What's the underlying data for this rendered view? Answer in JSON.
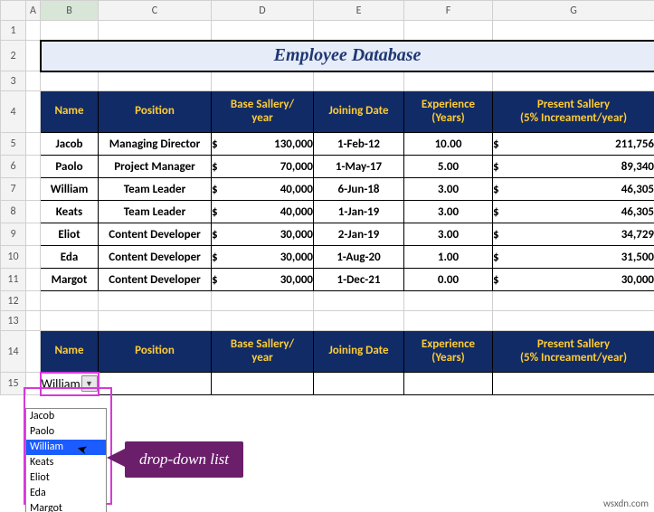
{
  "columns": [
    "A",
    "B",
    "C",
    "D",
    "E",
    "F",
    "G"
  ],
  "selected_column": "B",
  "title": "Employee Database",
  "headers": [
    "Name",
    "Position",
    "Base Sallery/\nyear",
    "Joining Date",
    "Experience\n(Years)",
    "Present Sallery\n(5% Increament/year)"
  ],
  "rows": [
    {
      "name": "Jacob",
      "position": "Managing Director",
      "base": "130,000",
      "join": "1-Feb-12",
      "exp": "10.00",
      "present": "211,756"
    },
    {
      "name": "Paolo",
      "position": "Project Manager",
      "base": "70,000",
      "join": "1-May-17",
      "exp": "5.00",
      "present": "89,340"
    },
    {
      "name": "William",
      "position": "Team Leader",
      "base": "40,000",
      "join": "6-Jun-18",
      "exp": "3.00",
      "present": "46,305"
    },
    {
      "name": "Keats",
      "position": "Team Leader",
      "base": "40,000",
      "join": "1-Jan-19",
      "exp": "3.00",
      "present": "46,305"
    },
    {
      "name": "Eliot",
      "position": "Content Developer",
      "base": "30,000",
      "join": "2-Jan-19",
      "exp": "3.00",
      "present": "34,729"
    },
    {
      "name": "Eda",
      "position": "Content Developer",
      "base": "30,000",
      "join": "1-Aug-20",
      "exp": "1.00",
      "present": "31,500"
    },
    {
      "name": "Margot",
      "position": "Content Developer",
      "base": "30,000",
      "join": "1-Dec-21",
      "exp": "0.00",
      "present": "30,000"
    }
  ],
  "currency": "$",
  "dropdown": {
    "selected": "William",
    "options": [
      "Jacob",
      "Paolo",
      "William",
      "Keats",
      "Eliot",
      "Eda",
      "Margot"
    ],
    "highlighted_index": 2
  },
  "callout": "drop-down list",
  "watermark": "wsxdn.com",
  "row_numbers": [
    1,
    2,
    3,
    4,
    5,
    6,
    7,
    8,
    9,
    10,
    11,
    12,
    13,
    14,
    15
  ]
}
